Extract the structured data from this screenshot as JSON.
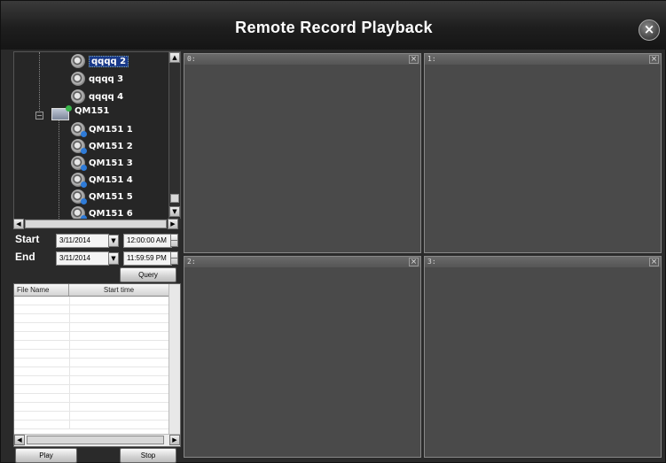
{
  "window": {
    "title": "Remote Record Playback",
    "close_glyph": "×"
  },
  "tree": {
    "items": [
      {
        "label": "qqqq 2",
        "selected": true,
        "icon": "camera-icon"
      },
      {
        "label": "qqqq 3",
        "icon": "camera-icon"
      },
      {
        "label": "qqqq 4",
        "icon": "camera-icon"
      },
      {
        "label": "QM151",
        "icon": "dvr-device-icon"
      },
      {
        "label": "QM151 1",
        "icon": "camera-icon"
      },
      {
        "label": "QM151 2",
        "icon": "camera-icon"
      },
      {
        "label": "QM151 3",
        "icon": "camera-icon"
      },
      {
        "label": "QM151 4",
        "icon": "camera-icon"
      },
      {
        "label": "QM151 5",
        "icon": "camera-icon"
      },
      {
        "label": "QM151 6",
        "icon": "camera-icon"
      }
    ],
    "expander_glyph": "−"
  },
  "query": {
    "start_label": "Start",
    "end_label": "End",
    "start_date": "3/11/2014",
    "start_time": "12:00:00 AM",
    "end_date": "3/11/2014",
    "end_time": "11:59:59 PM",
    "query_button": "Query"
  },
  "file_list": {
    "columns": [
      "File Name",
      "Start time"
    ]
  },
  "controls": {
    "play": "Play",
    "stop": "Stop"
  },
  "video": {
    "panels": [
      {
        "label": "0:"
      },
      {
        "label": "1:"
      },
      {
        "label": "2:"
      },
      {
        "label": "3:"
      }
    ],
    "close_glyph": "×"
  },
  "glyphs": {
    "up": "▲",
    "down": "▼",
    "left": "◀",
    "right": "▶"
  }
}
